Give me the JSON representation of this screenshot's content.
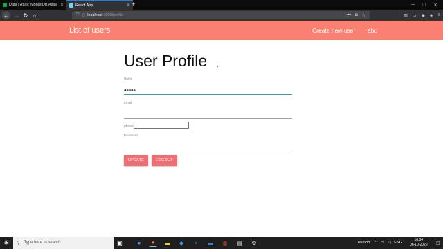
{
  "browser": {
    "tabs": [
      {
        "title": "Data | Atlas: MongoDB Atlas",
        "icon": "mongodb-leaf-icon",
        "active": false
      },
      {
        "title": "React App",
        "icon": "react-icon",
        "active": true
      }
    ],
    "new_tab": "+",
    "url": {
      "host": "localhost",
      "path": ":3000/profile"
    }
  },
  "navbar": {
    "brand": "List of users",
    "links": [
      "Create new user",
      "abc"
    ],
    "color": "#fa8072"
  },
  "page": {
    "title": "User Profile",
    "fields": {
      "name": {
        "label": "Name",
        "value": "aaaaa"
      },
      "email": {
        "label": "Email",
        "value": ""
      },
      "phone": {
        "label": "phone",
        "value": ""
      },
      "password": {
        "label": "Password",
        "value": ""
      }
    },
    "buttons": {
      "update": "UPDATE",
      "logout": "LOGOUT"
    },
    "button_color": "#ee6e73",
    "active_field_color": "#26a69a"
  },
  "taskbar": {
    "search_placeholder": "Type here to search",
    "tray": {
      "desktop": "Desktop",
      "language": "ENG"
    },
    "clock": {
      "time": "16:34",
      "date": "06-10-2020"
    }
  }
}
